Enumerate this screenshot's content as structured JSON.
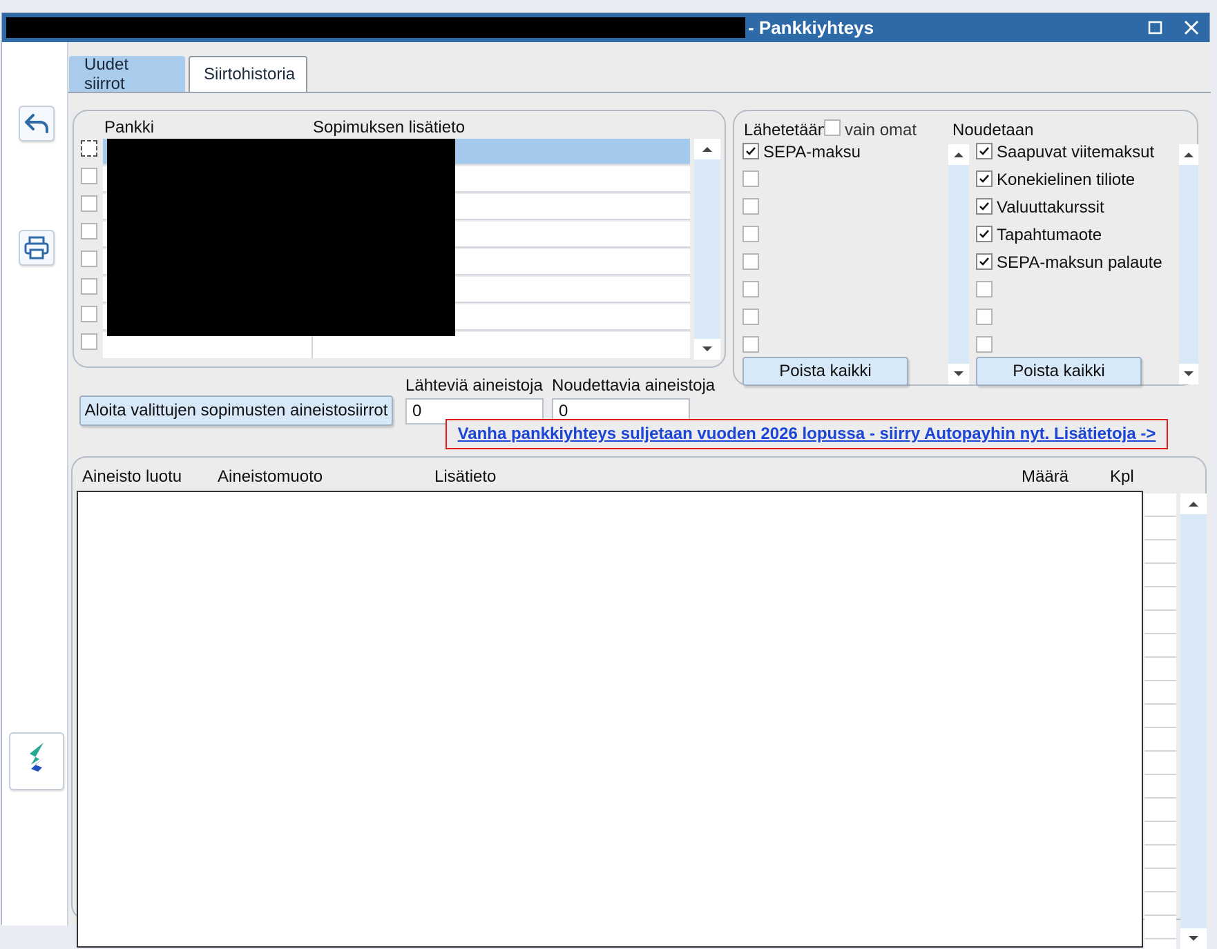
{
  "window": {
    "title_suffix": "- Pankkiyhteys",
    "maximize_icon": "maximize-icon",
    "close_icon": "close-icon",
    "colors": {
      "titlebar": "#2f6aa8",
      "accent": "#a9cbec",
      "link": "#1b45d6",
      "notice_border": "#e01c1c"
    }
  },
  "sidebar": {
    "items": [
      {
        "icon": "back-arrow-icon"
      },
      {
        "icon": "printer-icon"
      },
      {
        "icon": "app-logo-icon"
      }
    ]
  },
  "tabs": [
    {
      "label": "Uudet siirrot",
      "active": true
    },
    {
      "label": "Siirtohistoria",
      "active": false
    }
  ],
  "contracts": {
    "columns": [
      "Pankki",
      "Sopimuksen lisätieto"
    ],
    "row_count": 8,
    "selected_row": 0
  },
  "send": {
    "label": "Lähetetään",
    "own_only_label": "vain omat",
    "own_only_checked": false,
    "items": [
      {
        "label": "SEPA-maksu",
        "checked": true
      },
      {
        "label": "",
        "checked": false
      },
      {
        "label": "",
        "checked": false
      },
      {
        "label": "",
        "checked": false
      },
      {
        "label": "",
        "checked": false
      },
      {
        "label": "",
        "checked": false
      },
      {
        "label": "",
        "checked": false
      },
      {
        "label": "",
        "checked": false
      },
      {
        "label": "",
        "checked": false
      }
    ],
    "clear_button": "Poista kaikki"
  },
  "fetch": {
    "label": "Noudetaan",
    "items": [
      {
        "label": "Saapuvat viitemaksut",
        "checked": true
      },
      {
        "label": "Konekielinen tiliote",
        "checked": true
      },
      {
        "label": "Valuuttakurssit",
        "checked": true
      },
      {
        "label": "Tapahtumaote",
        "checked": true
      },
      {
        "label": "SEPA-maksun palaute",
        "checked": true
      },
      {
        "label": "",
        "checked": false
      },
      {
        "label": "",
        "checked": false
      },
      {
        "label": "",
        "checked": false
      },
      {
        "label": "",
        "checked": false
      }
    ],
    "clear_button": "Poista kaikki"
  },
  "actions": {
    "start_button": "Aloita valittujen sopimusten aineistosiirrot",
    "outgoing_label": "Lähteviä aineistoja",
    "outgoing_value": "0",
    "incoming_label": "Noudettavia aineistoja",
    "incoming_value": "0"
  },
  "notice": {
    "text": "Vanha pankkiyhteys suljetaan vuoden 2026 lopussa - siirry Autopayhin nyt. Lisätietoja ->"
  },
  "materials": {
    "columns": [
      "Aineisto luotu",
      "Aineistomuoto",
      "Lisätieto",
      "Määrä",
      "Kpl"
    ],
    "rows": []
  }
}
